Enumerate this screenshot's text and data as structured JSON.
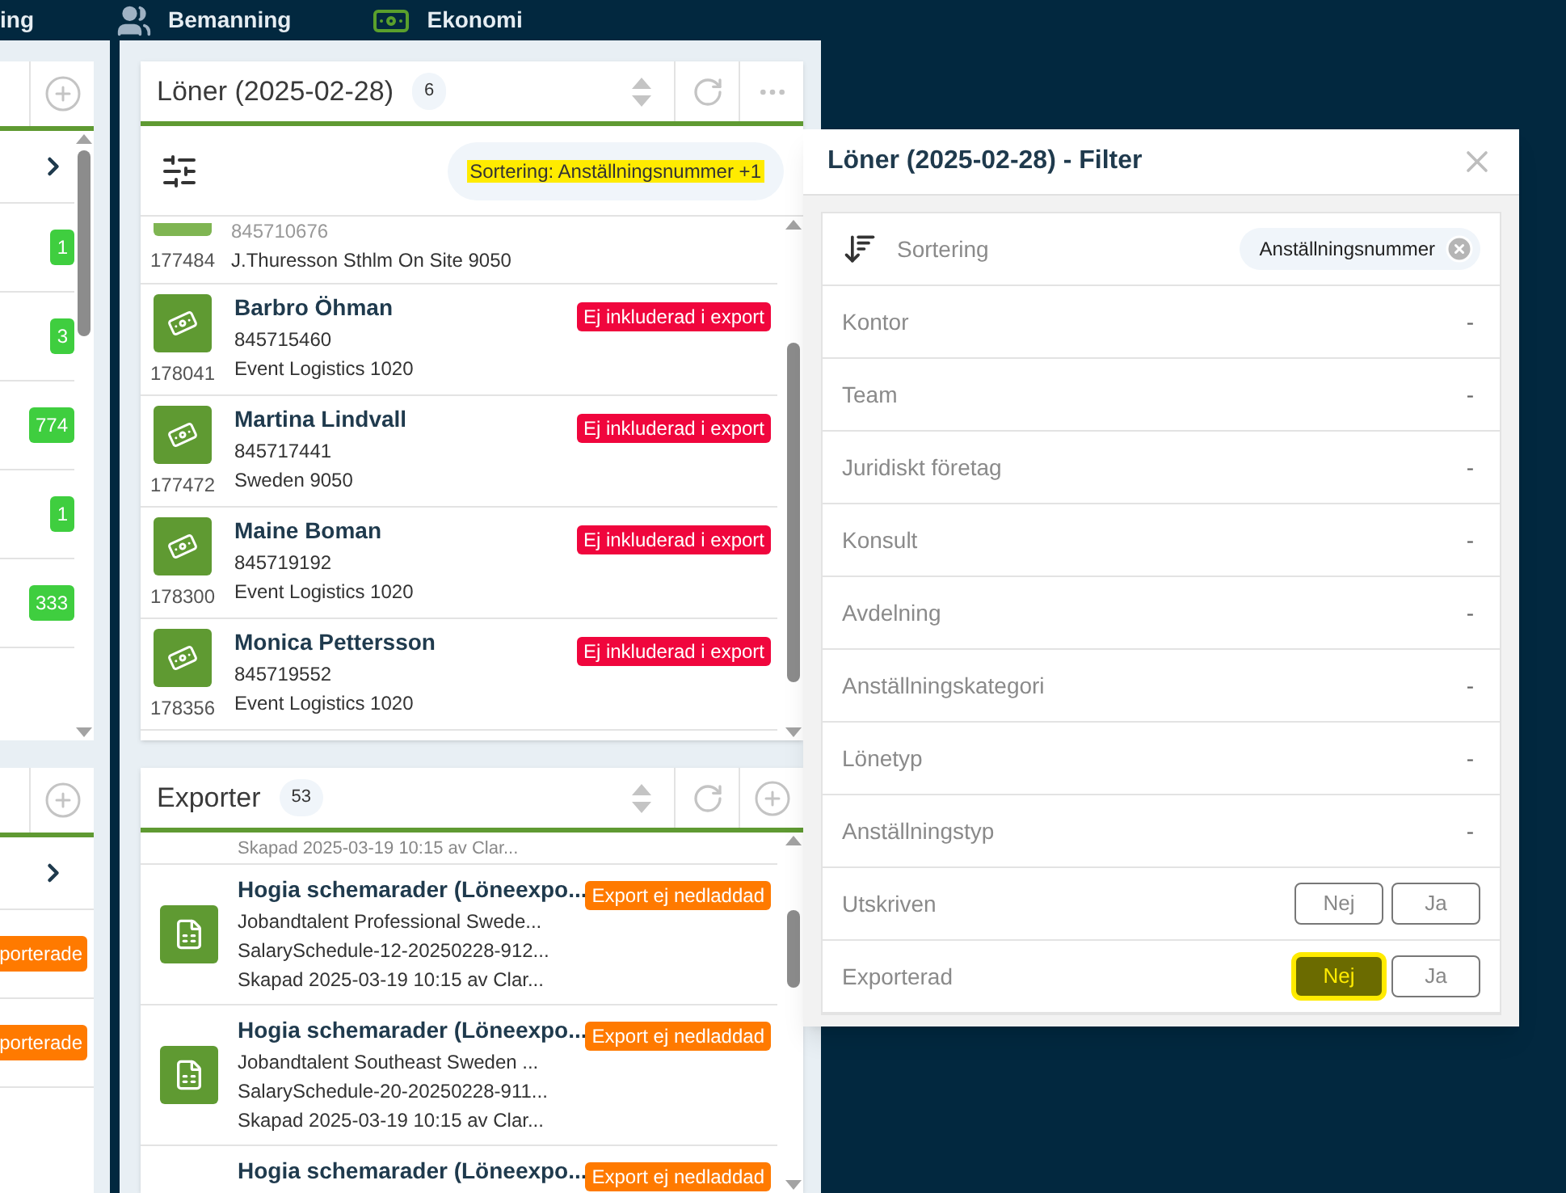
{
  "nav": [
    {
      "label": "ing"
    },
    {
      "label": "Bemanning"
    },
    {
      "label": "Ekonomi"
    }
  ],
  "left_top_panel": {
    "badges": [
      "1",
      "3",
      "774",
      "1",
      "333"
    ]
  },
  "left_bottom_panel": {
    "badges": [
      "porterade",
      "porterade"
    ]
  },
  "salary_panel": {
    "title": "Löner (2025-02-28)",
    "count": "6",
    "filter_chip": {
      "text": "Sortering: Anställningsnummer +1",
      "highlighted": true
    },
    "rows": [
      {
        "kind": "partial",
        "id": "177484",
        "number": "845710676",
        "location": "J.Thuresson Sthlm On Site 9050"
      },
      {
        "kind": "full",
        "id": "178041",
        "name": "Barbro Öhman",
        "number": "845715460",
        "location": "Event Logistics 1020",
        "badge": "Ej inkluderad i export"
      },
      {
        "kind": "full",
        "id": "177472",
        "name": "Martina Lindvall",
        "number": "845717441",
        "location": "Sweden 9050",
        "badge": "Ej inkluderad i export"
      },
      {
        "kind": "full",
        "id": "178300",
        "name": "Maine Boman",
        "number": "845719192",
        "location": "Event Logistics 1020",
        "badge": "Ej inkluderad i export"
      },
      {
        "kind": "full",
        "id": "178356",
        "name": "Monica Pettersson",
        "number": "845719552",
        "location": "Event Logistics 1020",
        "badge": "Ej inkluderad i export"
      }
    ]
  },
  "export_panel": {
    "title": "Exporter",
    "count": "53",
    "rows": [
      {
        "kind": "partial",
        "created": "Skapad 2025-03-19 10:15 av Clar..."
      },
      {
        "kind": "full",
        "title": "Hogia schemarader (Löneexpo...",
        "customer": "Jobandtalent Professional Swede...",
        "file": "SalarySchedule-12-20250228-912...",
        "created": "Skapad 2025-03-19 10:15 av Clar...",
        "badge": "Export ej nedladdad"
      },
      {
        "kind": "full",
        "title": "Hogia schemarader (Löneexpo...",
        "customer": "Jobandtalent Southeast Sweden ...",
        "file": "SalarySchedule-20-20250228-911...",
        "created": "Skapad 2025-03-19 10:15 av Clar...",
        "badge": "Export ej nedladdad"
      },
      {
        "kind": "title_only",
        "title": "Hogia schemarader (Löneexpo...",
        "badge": "Export ej nedladdad"
      }
    ]
  },
  "filter_dialog": {
    "title": "Löner (2025-02-28) - Filter",
    "sort": {
      "label": "Sortering",
      "value": "Anställningsnummer"
    },
    "fields": [
      {
        "kind": "select",
        "label": "Kontor",
        "value": "-"
      },
      {
        "kind": "select",
        "label": "Team",
        "value": "-"
      },
      {
        "kind": "select",
        "label": "Juridiskt företag",
        "value": "-"
      },
      {
        "kind": "select",
        "label": "Konsult",
        "value": "-"
      },
      {
        "kind": "select",
        "label": "Avdelning",
        "value": "-"
      },
      {
        "kind": "select",
        "label": "Anställningskategori",
        "value": "-"
      },
      {
        "kind": "select",
        "label": "Lönetyp",
        "value": "-"
      },
      {
        "kind": "select",
        "label": "Anställningstyp",
        "value": "-"
      },
      {
        "kind": "toggle",
        "label": "Utskriven",
        "options": [
          {
            "label": "Nej",
            "selected": false,
            "highlighted": false
          },
          {
            "label": "Ja",
            "selected": false,
            "highlighted": false
          }
        ]
      },
      {
        "kind": "toggle",
        "label": "Exporterad",
        "options": [
          {
            "label": "Nej",
            "selected": true,
            "highlighted": true
          },
          {
            "label": "Ja",
            "selected": false,
            "highlighted": false
          }
        ]
      }
    ]
  }
}
